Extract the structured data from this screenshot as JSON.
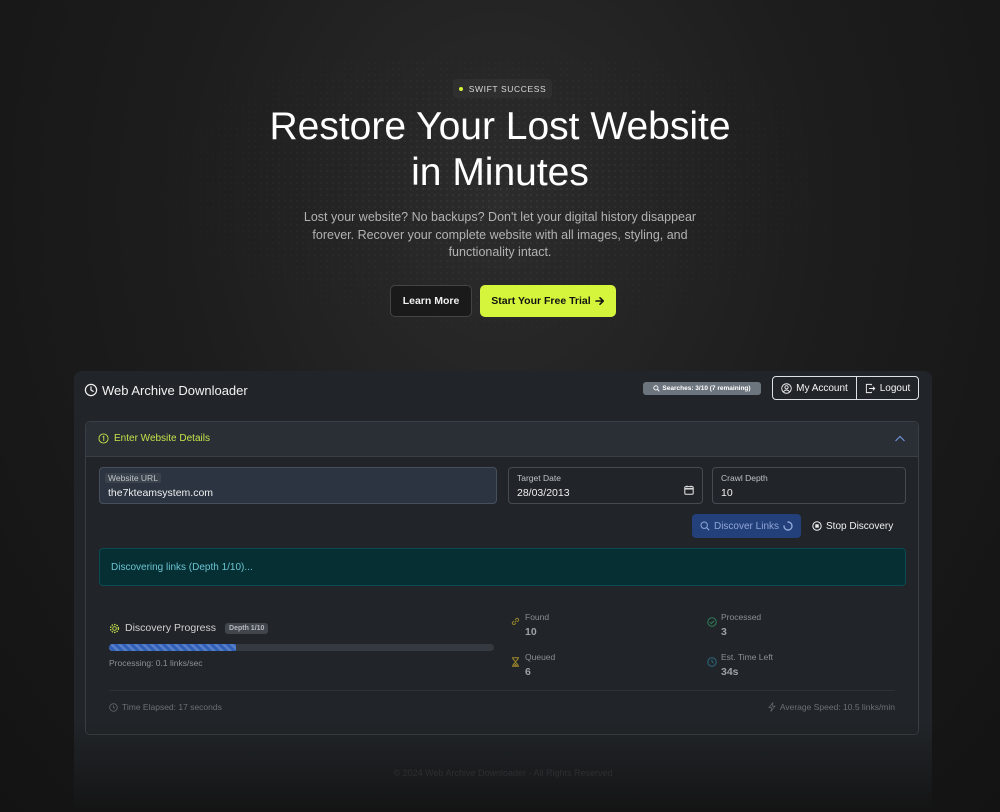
{
  "hero": {
    "badge": "SWIFT SUCCESS",
    "title_line1": "Restore Your Lost Website",
    "title_line2": "in Minutes",
    "subtitle": "Lost your website? No backups? Don't let your digital history disappear forever. Recover your complete website with all images, styling, and functionality intact.",
    "learn_more": "Learn More",
    "free_trial": "Start Your Free Trial",
    "accent_color": "#d5f53c"
  },
  "app": {
    "title": "Web Archive Downloader",
    "searches_badge": "Searches: 3/10 (7 remaining)",
    "my_account": "My Account",
    "logout": "Logout",
    "card": {
      "header": "Enter Website Details",
      "url_label": "Website URL",
      "url_value": "the7kteamsystem.com",
      "date_label": "Target Date",
      "date_value": "28/03/2013",
      "depth_label": "Crawl Depth",
      "depth_value": "10",
      "discover_button": "Discover Links",
      "stop_button": "Stop Discovery",
      "alert_text": "Discovering links (Depth 1/10)..."
    },
    "progress": {
      "title": "Discovery Progress",
      "depth_badge": "Depth 1/10",
      "percent": 33,
      "rate": "Processing: 0.1 links/sec",
      "found_label": "Found",
      "found_value": "10",
      "processed_label": "Processed",
      "processed_value": "3",
      "queued_label": "Queued",
      "queued_value": "6",
      "time_left_label": "Est. Time Left",
      "time_left_value": "34s",
      "elapsed": "Time Elapsed: 17 seconds",
      "avg_speed": "Average Speed: 10.5 links/min"
    },
    "copyright": "© 2024 Web Archive Downloader - All Rights Reserved"
  }
}
